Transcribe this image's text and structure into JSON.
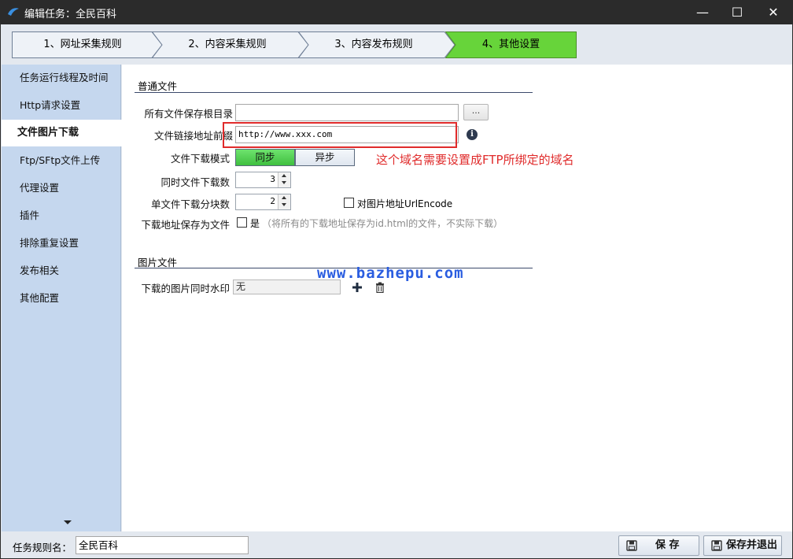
{
  "window": {
    "title": "编辑任务：全民百科",
    "minimize": "—",
    "maximize": "☐",
    "close": "✕"
  },
  "steps": [
    {
      "label": "1、网址采集规则",
      "active": false
    },
    {
      "label": "2、内容采集规则",
      "active": false
    },
    {
      "label": "3、内容发布规则",
      "active": false
    },
    {
      "label": "4、其他设置",
      "active": true
    }
  ],
  "sidebar": {
    "items": [
      {
        "label": "任务运行线程及时间"
      },
      {
        "label": "Http请求设置"
      },
      {
        "label": "文件图片下载",
        "active": true
      },
      {
        "label": "Ftp/SFtp文件上传"
      },
      {
        "label": "代理设置"
      },
      {
        "label": "插件"
      },
      {
        "label": "排除重复设置"
      },
      {
        "label": "发布相关"
      },
      {
        "label": "其他配置"
      }
    ]
  },
  "general_files": {
    "section_title": "普通文件",
    "save_root_label": "所有文件保存根目录",
    "save_root_value": "",
    "browse_label": "...",
    "link_prefix_label": "文件链接地址前缀",
    "link_prefix_value": "http://www.xxx.com",
    "annotation": "这个域名需要设置成FTP所绑定的域名",
    "download_mode_label": "文件下载模式",
    "mode_sync": "同步",
    "mode_async": "异步",
    "selected_mode": "同步",
    "concurrent_label": "同时文件下载数",
    "concurrent_value": "3",
    "chunks_label": "单文件下载分块数",
    "chunks_value": "2",
    "urlencode_label": "对图片地址UrlEncode",
    "urlencode_checked": false,
    "save_as_file_label": "下载地址保存为文件",
    "save_as_file_checkbox_label": "是",
    "save_as_file_checked": false,
    "save_as_file_hint": "（将所有的下载地址保存为id.html的文件，不实际下载）"
  },
  "image_files": {
    "section_title": "图片文件",
    "watermark_label": "下载的图片同时水印",
    "watermark_value": "无"
  },
  "watermark_text": "www.bazhepu.com",
  "footer": {
    "rule_name_label": "任务规则名：",
    "rule_name_value": "全民百科",
    "save_label": "保 存",
    "save_exit_label": "保存并退出"
  },
  "colors": {
    "title_bar": "#2b2b2b",
    "step_active": "#67d43a",
    "sidebar_bg": "#c5d7ee",
    "annotation_red": "#e02b2b",
    "watermark_blue": "#2a5de0"
  }
}
